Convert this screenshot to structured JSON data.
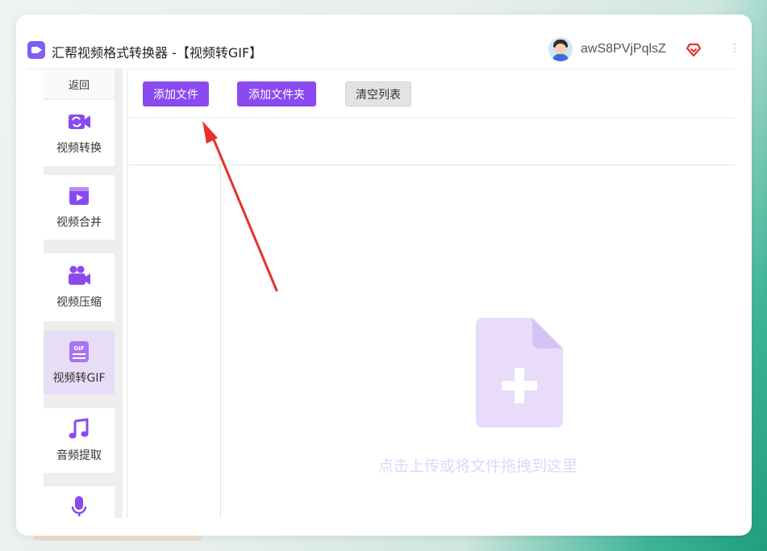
{
  "app": {
    "title": "汇帮视频格式转换器  -【视频转GIF】",
    "username": "awS8PVjPqlsZ",
    "more": "⋮"
  },
  "sidebar": {
    "back_label": "返回",
    "items": [
      {
        "label": "视频转换",
        "icon": "video-convert-icon",
        "active": false
      },
      {
        "label": "视频合并",
        "icon": "video-merge-icon",
        "active": false
      },
      {
        "label": "视频压缩",
        "icon": "video-compress-icon",
        "active": false
      },
      {
        "label": "视频转GIF",
        "icon": "gif-icon",
        "active": true
      },
      {
        "label": "音频提取",
        "icon": "music-note-icon",
        "active": false
      },
      {
        "label": "",
        "icon": "microphone-icon",
        "active": false
      }
    ],
    "gif_badge": "GIF"
  },
  "toolbar": {
    "add_file": "添加文件",
    "add_folder": "添加文件夹",
    "clear_list": "清空列表"
  },
  "drop_zone": {
    "hint": "点击上传或将文件拖拽到这里"
  },
  "colors": {
    "accent": "#8a4af0",
    "accent_light": "#e3d5f7",
    "active_nav": "#e7ddf6",
    "arrow": "#e8312c"
  }
}
